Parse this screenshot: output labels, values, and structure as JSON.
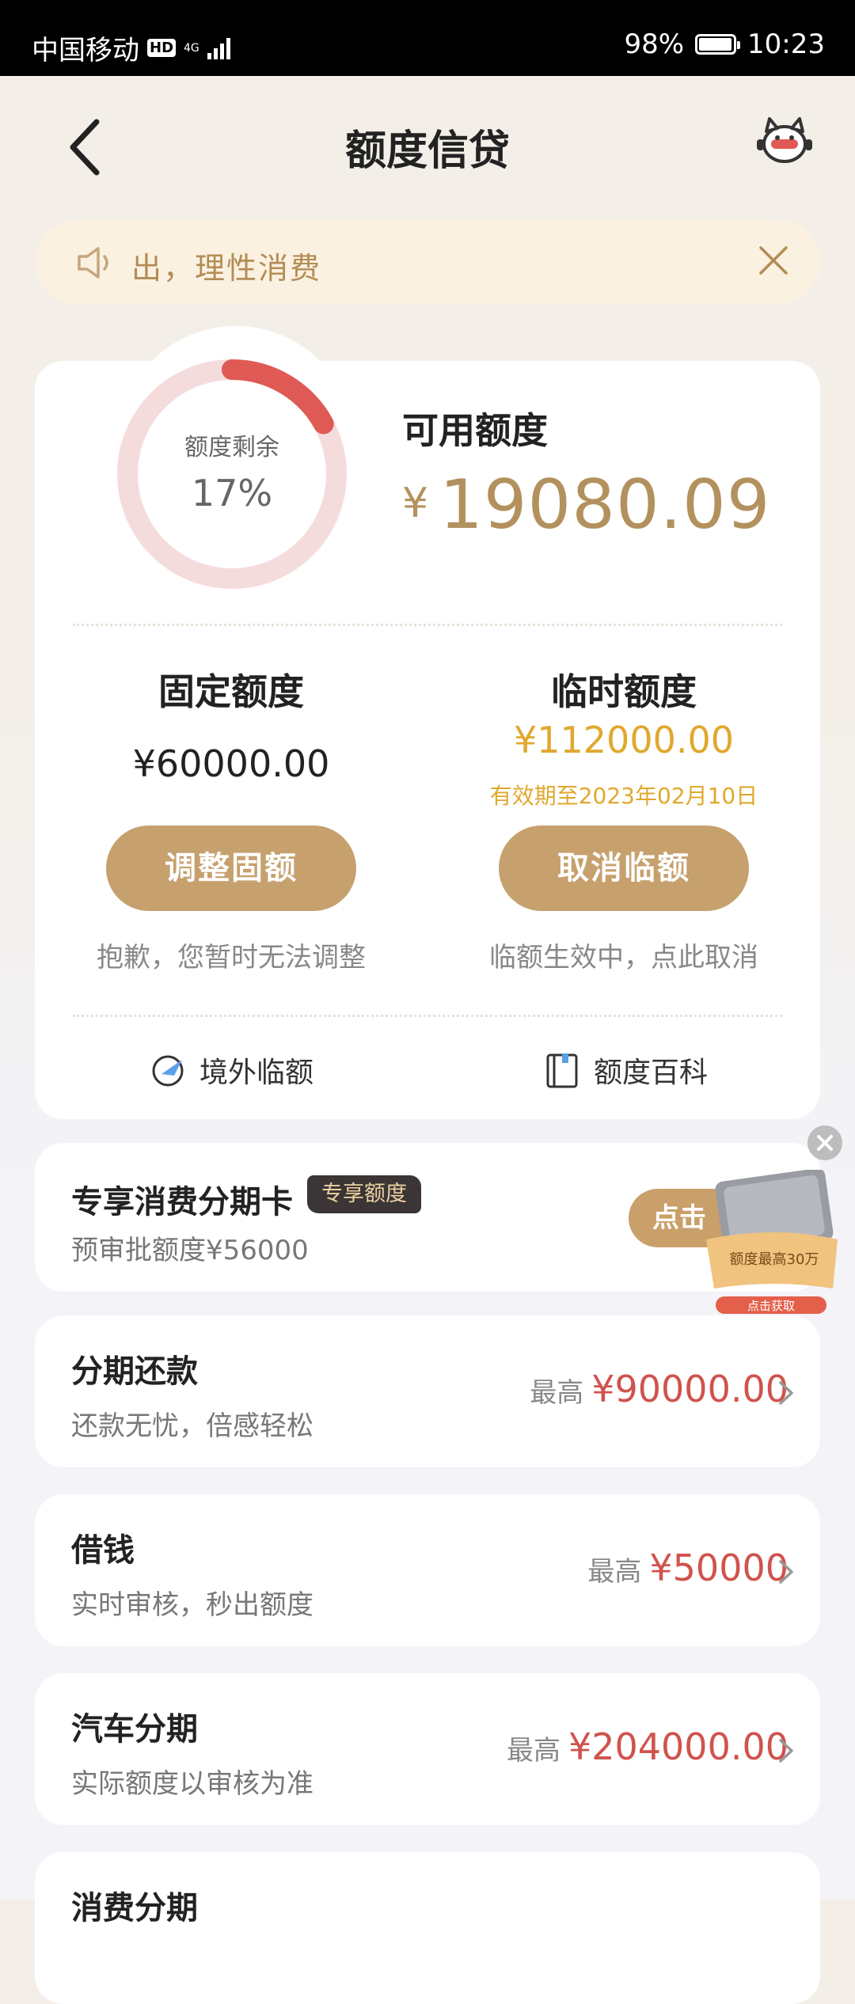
{
  "status_bar": {
    "carrier": "中国移动",
    "hd": "HD",
    "net": "4G",
    "battery": "98%",
    "time": "10:23"
  },
  "header": {
    "title": "额度信贷"
  },
  "notice": {
    "text": "出，理性消费"
  },
  "credit": {
    "ring_label": "额度剩余",
    "ring_percent": "17%",
    "ring_fraction": 0.17,
    "available_label": "可用额度",
    "available_symbol": "¥",
    "available_amount": "19080.09",
    "fixed": {
      "title": "固定额度",
      "amount": "¥60000.00",
      "button": "调整固额",
      "hint": "抱歉，您暂时无法调整"
    },
    "temporary": {
      "title": "临时额度",
      "amount": "¥112000.00",
      "valid_until": "有效期至2023年02月10日",
      "button": "取消临额",
      "hint": "临额生效中，点此取消"
    },
    "links": [
      {
        "label": "境外临额"
      },
      {
        "label": "额度百科"
      }
    ]
  },
  "promo": {
    "title": "专享消费分期卡",
    "badge": "专享额度",
    "subtitle": "预审批额度¥56000",
    "button": "点击",
    "card_caption": "额度最高30万",
    "card_button": "点击获取"
  },
  "products": [
    {
      "title": "分期还款",
      "subtitle": "还款无忧，倍感轻松",
      "prefix": "最高",
      "amount": "¥90000.00"
    },
    {
      "title": "借钱",
      "subtitle": "实时审核，秒出额度",
      "prefix": "最高",
      "amount": "¥50000"
    },
    {
      "title": "汽车分期",
      "subtitle": "实际额度以审核为准",
      "prefix": "最高",
      "amount": "¥204000.00"
    },
    {
      "title": "消费分期"
    }
  ],
  "colors": {
    "accent": "#c6a06d",
    "gold_text": "#b3915e",
    "temp_amount": "#e0a82e",
    "amount_red": "#d0534d",
    "ring_track": "#f5dcdc",
    "ring_fill": "#e05a55"
  }
}
